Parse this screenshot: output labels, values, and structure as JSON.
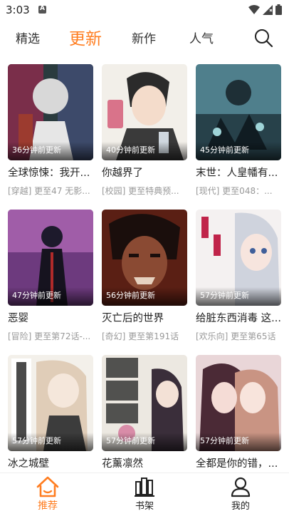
{
  "status": {
    "time": "3:03"
  },
  "tabs": [
    {
      "label": "精选",
      "active": false
    },
    {
      "label": "更新",
      "active": true
    },
    {
      "label": "新作",
      "active": false
    },
    {
      "label": "人气",
      "active": false
    }
  ],
  "colors": {
    "accent": "#ff7d20"
  },
  "comics": [
    {
      "title": "全球惊悚：我开...",
      "updated": "36分钟前更新",
      "sub": "[穿越] 更至47 无影..."
    },
    {
      "title": "你越界了",
      "updated": "40分钟前更新",
      "sub": "[校园] 更至特典预..."
    },
    {
      "title": "末世：人皇幡有...",
      "updated": "45分钟前更新",
      "sub": "[现代] 更至048：..."
    },
    {
      "title": "恶婴",
      "updated": "47分钟前更新",
      "sub": "[冒险] 更至第72话-..."
    },
    {
      "title": "灭亡后的世界",
      "updated": "56分钟前更新",
      "sub": "[奇幻] 更至第191话"
    },
    {
      "title": "给脏东西消毒 这...",
      "updated": "57分钟前更新",
      "sub": "[欢乐向] 更至第65话"
    },
    {
      "title": "冰之城壁",
      "updated": "57分钟前更新",
      "sub": ""
    },
    {
      "title": "花薰凛然",
      "updated": "57分钟前更新",
      "sub": ""
    },
    {
      "title": "全都是你的错，...",
      "updated": "57分钟前更新",
      "sub": ""
    }
  ],
  "bottom_nav": [
    {
      "label": "推荐",
      "icon": "home-icon",
      "active": true
    },
    {
      "label": "书架",
      "icon": "bookshelf-icon",
      "active": false
    },
    {
      "label": "我的",
      "icon": "profile-icon",
      "active": false
    }
  ]
}
